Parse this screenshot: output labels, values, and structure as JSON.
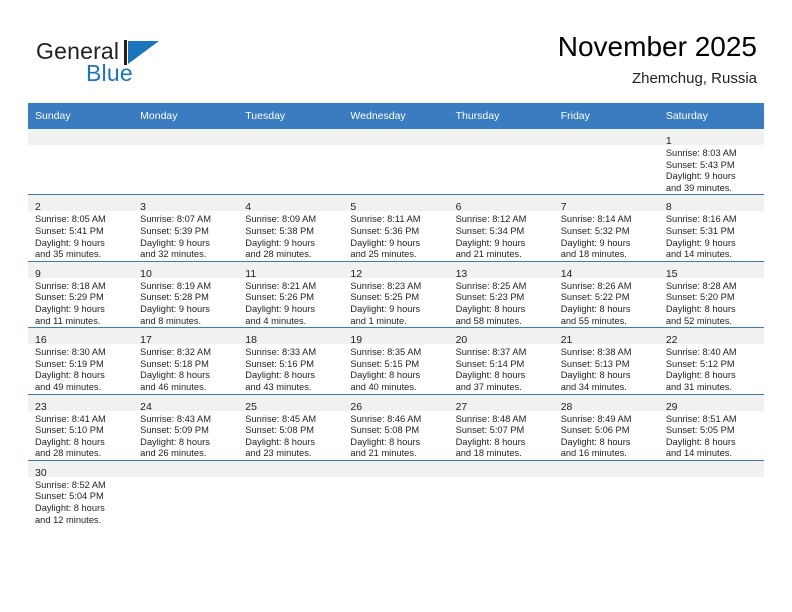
{
  "brand": {
    "name_top": "General",
    "name_bottom": "Blue",
    "accent_color": "#1b75bb",
    "logo_icon": "triangle-flag-icon"
  },
  "header": {
    "title": "November 2025",
    "subtitle": "Zhemchug, Russia"
  },
  "calendar": {
    "header_bg": "#3a7cc0",
    "header_text_color": "#ffffff",
    "daynum_bg": "#f1f1f1",
    "grid_line_color": "#3a7cc0",
    "weekday_headers": [
      "Sunday",
      "Monday",
      "Tuesday",
      "Wednesday",
      "Thursday",
      "Friday",
      "Saturday"
    ],
    "weeks": [
      [
        {
          "day": "",
          "empty": true,
          "lines": []
        },
        {
          "day": "",
          "empty": true,
          "lines": []
        },
        {
          "day": "",
          "empty": true,
          "lines": []
        },
        {
          "day": "",
          "empty": true,
          "lines": []
        },
        {
          "day": "",
          "empty": true,
          "lines": []
        },
        {
          "day": "",
          "empty": true,
          "lines": []
        },
        {
          "day": "1",
          "empty": false,
          "lines": [
            "Sunrise: 8:03 AM",
            "Sunset: 5:43 PM",
            "Daylight: 9 hours",
            "and 39 minutes."
          ]
        }
      ],
      [
        {
          "day": "2",
          "empty": false,
          "lines": [
            "Sunrise: 8:05 AM",
            "Sunset: 5:41 PM",
            "Daylight: 9 hours",
            "and 35 minutes."
          ]
        },
        {
          "day": "3",
          "empty": false,
          "lines": [
            "Sunrise: 8:07 AM",
            "Sunset: 5:39 PM",
            "Daylight: 9 hours",
            "and 32 minutes."
          ]
        },
        {
          "day": "4",
          "empty": false,
          "lines": [
            "Sunrise: 8:09 AM",
            "Sunset: 5:38 PM",
            "Daylight: 9 hours",
            "and 28 minutes."
          ]
        },
        {
          "day": "5",
          "empty": false,
          "lines": [
            "Sunrise: 8:11 AM",
            "Sunset: 5:36 PM",
            "Daylight: 9 hours",
            "and 25 minutes."
          ]
        },
        {
          "day": "6",
          "empty": false,
          "lines": [
            "Sunrise: 8:12 AM",
            "Sunset: 5:34 PM",
            "Daylight: 9 hours",
            "and 21 minutes."
          ]
        },
        {
          "day": "7",
          "empty": false,
          "lines": [
            "Sunrise: 8:14 AM",
            "Sunset: 5:32 PM",
            "Daylight: 9 hours",
            "and 18 minutes."
          ]
        },
        {
          "day": "8",
          "empty": false,
          "lines": [
            "Sunrise: 8:16 AM",
            "Sunset: 5:31 PM",
            "Daylight: 9 hours",
            "and 14 minutes."
          ]
        }
      ],
      [
        {
          "day": "9",
          "empty": false,
          "lines": [
            "Sunrise: 8:18 AM",
            "Sunset: 5:29 PM",
            "Daylight: 9 hours",
            "and 11 minutes."
          ]
        },
        {
          "day": "10",
          "empty": false,
          "lines": [
            "Sunrise: 8:19 AM",
            "Sunset: 5:28 PM",
            "Daylight: 9 hours",
            "and 8 minutes."
          ]
        },
        {
          "day": "11",
          "empty": false,
          "lines": [
            "Sunrise: 8:21 AM",
            "Sunset: 5:26 PM",
            "Daylight: 9 hours",
            "and 4 minutes."
          ]
        },
        {
          "day": "12",
          "empty": false,
          "lines": [
            "Sunrise: 8:23 AM",
            "Sunset: 5:25 PM",
            "Daylight: 9 hours",
            "and 1 minute."
          ]
        },
        {
          "day": "13",
          "empty": false,
          "lines": [
            "Sunrise: 8:25 AM",
            "Sunset: 5:23 PM",
            "Daylight: 8 hours",
            "and 58 minutes."
          ]
        },
        {
          "day": "14",
          "empty": false,
          "lines": [
            "Sunrise: 8:26 AM",
            "Sunset: 5:22 PM",
            "Daylight: 8 hours",
            "and 55 minutes."
          ]
        },
        {
          "day": "15",
          "empty": false,
          "lines": [
            "Sunrise: 8:28 AM",
            "Sunset: 5:20 PM",
            "Daylight: 8 hours",
            "and 52 minutes."
          ]
        }
      ],
      [
        {
          "day": "16",
          "empty": false,
          "lines": [
            "Sunrise: 8:30 AM",
            "Sunset: 5:19 PM",
            "Daylight: 8 hours",
            "and 49 minutes."
          ]
        },
        {
          "day": "17",
          "empty": false,
          "lines": [
            "Sunrise: 8:32 AM",
            "Sunset: 5:18 PM",
            "Daylight: 8 hours",
            "and 46 minutes."
          ]
        },
        {
          "day": "18",
          "empty": false,
          "lines": [
            "Sunrise: 8:33 AM",
            "Sunset: 5:16 PM",
            "Daylight: 8 hours",
            "and 43 minutes."
          ]
        },
        {
          "day": "19",
          "empty": false,
          "lines": [
            "Sunrise: 8:35 AM",
            "Sunset: 5:15 PM",
            "Daylight: 8 hours",
            "and 40 minutes."
          ]
        },
        {
          "day": "20",
          "empty": false,
          "lines": [
            "Sunrise: 8:37 AM",
            "Sunset: 5:14 PM",
            "Daylight: 8 hours",
            "and 37 minutes."
          ]
        },
        {
          "day": "21",
          "empty": false,
          "lines": [
            "Sunrise: 8:38 AM",
            "Sunset: 5:13 PM",
            "Daylight: 8 hours",
            "and 34 minutes."
          ]
        },
        {
          "day": "22",
          "empty": false,
          "lines": [
            "Sunrise: 8:40 AM",
            "Sunset: 5:12 PM",
            "Daylight: 8 hours",
            "and 31 minutes."
          ]
        }
      ],
      [
        {
          "day": "23",
          "empty": false,
          "lines": [
            "Sunrise: 8:41 AM",
            "Sunset: 5:10 PM",
            "Daylight: 8 hours",
            "and 28 minutes."
          ]
        },
        {
          "day": "24",
          "empty": false,
          "lines": [
            "Sunrise: 8:43 AM",
            "Sunset: 5:09 PM",
            "Daylight: 8 hours",
            "and 26 minutes."
          ]
        },
        {
          "day": "25",
          "empty": false,
          "lines": [
            "Sunrise: 8:45 AM",
            "Sunset: 5:08 PM",
            "Daylight: 8 hours",
            "and 23 minutes."
          ]
        },
        {
          "day": "26",
          "empty": false,
          "lines": [
            "Sunrise: 8:46 AM",
            "Sunset: 5:08 PM",
            "Daylight: 8 hours",
            "and 21 minutes."
          ]
        },
        {
          "day": "27",
          "empty": false,
          "lines": [
            "Sunrise: 8:48 AM",
            "Sunset: 5:07 PM",
            "Daylight: 8 hours",
            "and 18 minutes."
          ]
        },
        {
          "day": "28",
          "empty": false,
          "lines": [
            "Sunrise: 8:49 AM",
            "Sunset: 5:06 PM",
            "Daylight: 8 hours",
            "and 16 minutes."
          ]
        },
        {
          "day": "29",
          "empty": false,
          "lines": [
            "Sunrise: 8:51 AM",
            "Sunset: 5:05 PM",
            "Daylight: 8 hours",
            "and 14 minutes."
          ]
        }
      ],
      [
        {
          "day": "30",
          "empty": false,
          "lines": [
            "Sunrise: 8:52 AM",
            "Sunset: 5:04 PM",
            "Daylight: 8 hours",
            "and 12 minutes."
          ]
        },
        {
          "day": "",
          "empty": true,
          "lines": []
        },
        {
          "day": "",
          "empty": true,
          "lines": []
        },
        {
          "day": "",
          "empty": true,
          "lines": []
        },
        {
          "day": "",
          "empty": true,
          "lines": []
        },
        {
          "day": "",
          "empty": true,
          "lines": []
        },
        {
          "day": "",
          "empty": true,
          "lines": []
        }
      ]
    ]
  }
}
